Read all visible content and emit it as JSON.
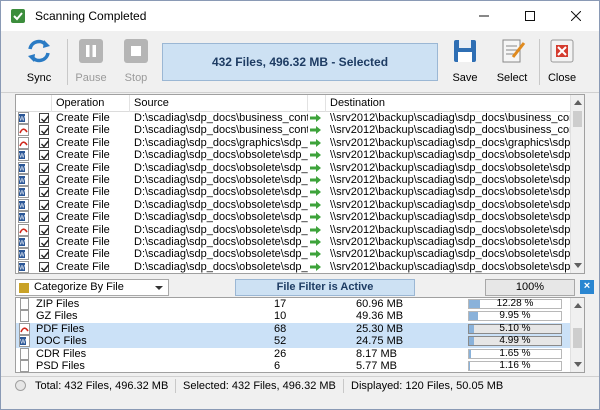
{
  "window": {
    "title": "Scanning Completed"
  },
  "toolbar": {
    "sync": "Sync",
    "pause": "Pause",
    "stop": "Stop",
    "status": "432 Files, 496.32 MB - Selected",
    "save": "Save",
    "select": "Select",
    "close": "Close"
  },
  "grid": {
    "columns": {
      "operation": "Operation",
      "source": "Source",
      "destination": "Destination"
    },
    "rows": [
      {
        "type": "doc",
        "checked": true,
        "operation": "Create File",
        "source": "D:\\scadiag\\sdp_docs\\business_continuit...",
        "destination": "\\\\srv2012\\backup\\scadiag\\sdp_docs\\business_continuity..."
      },
      {
        "type": "pdf",
        "checked": true,
        "operation": "Create File",
        "source": "D:\\scadiag\\sdp_docs\\business_continuit...",
        "destination": "\\\\srv2012\\backup\\scadiag\\sdp_docs\\business_continuity..."
      },
      {
        "type": "pdf",
        "checked": true,
        "operation": "Create File",
        "source": "D:\\scadiag\\sdp_docs\\graphics\\sdp_cd\\s...",
        "destination": "\\\\srv2012\\backup\\scadiag\\sdp_docs\\graphics\\sdp_cd\\sd..."
      },
      {
        "type": "doc",
        "checked": true,
        "operation": "Create File",
        "source": "D:\\scadiag\\sdp_docs\\obsolete\\sdp_artic...",
        "destination": "\\\\srv2012\\backup\\scadiag\\sdp_docs\\obsolete\\sdp_articl..."
      },
      {
        "type": "doc",
        "checked": true,
        "operation": "Create File",
        "source": "D:\\scadiag\\sdp_docs\\obsolete\\sdp_artic...",
        "destination": "\\\\srv2012\\backup\\scadiag\\sdp_docs\\obsolete\\sdp_articl..."
      },
      {
        "type": "doc",
        "checked": true,
        "operation": "Create File",
        "source": "D:\\scadiag\\sdp_docs\\obsolete\\sdp_artic...",
        "destination": "\\\\srv2012\\backup\\scadiag\\sdp_docs\\obsolete\\sdp_articl..."
      },
      {
        "type": "doc",
        "checked": true,
        "operation": "Create File",
        "source": "D:\\scadiag\\sdp_docs\\obsolete\\sdp_artic...",
        "destination": "\\\\srv2012\\backup\\scadiag\\sdp_docs\\obsolete\\sdp_articl..."
      },
      {
        "type": "doc",
        "checked": true,
        "operation": "Create File",
        "source": "D:\\scadiag\\sdp_docs\\obsolete\\sdp_dev_...",
        "destination": "\\\\srv2012\\backup\\scadiag\\sdp_docs\\obsolete\\sdp_dev_s..."
      },
      {
        "type": "doc",
        "checked": true,
        "operation": "Create File",
        "source": "D:\\scadiag\\sdp_docs\\obsolete\\sdp_dev_...",
        "destination": "\\\\srv2012\\backup\\scadiag\\sdp_docs\\obsolete\\sdp_dev_s..."
      },
      {
        "type": "pdf",
        "checked": true,
        "operation": "Create File",
        "source": "D:\\scadiag\\sdp_docs\\obsolete\\sdp_dev_...",
        "destination": "\\\\srv2012\\backup\\scadiag\\sdp_docs\\obsolete\\sdp_dev_s..."
      },
      {
        "type": "doc",
        "checked": true,
        "operation": "Create File",
        "source": "D:\\scadiag\\sdp_docs\\obsolete\\sdp_dev_...",
        "destination": "\\\\srv2012\\backup\\scadiag\\sdp_docs\\obsolete\\sdp_dev_s..."
      },
      {
        "type": "doc",
        "checked": true,
        "operation": "Create File",
        "source": "D:\\scadiag\\sdp_docs\\obsolete\\sdp_dev_...",
        "destination": "\\\\srv2012\\backup\\scadiag\\sdp_docs\\obsolete\\sdp_dev_s..."
      },
      {
        "type": "doc",
        "checked": true,
        "operation": "Create File",
        "source": "D:\\scadiag\\sdp_docs\\obsolete\\sdp_dts_...",
        "destination": "\\\\srv2012\\backup\\scadiag\\sdp_docs\\obsolete\\sdp_dts_s..."
      }
    ]
  },
  "filter": {
    "category": "Categorize By File Extension",
    "status": "File Filter is Active",
    "percent": "100%"
  },
  "categories": [
    {
      "type": "generic",
      "name": "ZIP Files",
      "count": "17",
      "size": "60.96 MB",
      "percent_label": "12.28 %",
      "percent": 12.28,
      "selected": false
    },
    {
      "type": "generic",
      "name": "GZ Files",
      "count": "10",
      "size": "49.36 MB",
      "percent_label": "9.95 %",
      "percent": 9.95,
      "selected": false
    },
    {
      "type": "pdf",
      "name": "PDF Files",
      "count": "68",
      "size": "25.30 MB",
      "percent_label": "5.10 %",
      "percent": 5.1,
      "selected": true
    },
    {
      "type": "doc",
      "name": "DOC Files",
      "count": "52",
      "size": "24.75 MB",
      "percent_label": "4.99 %",
      "percent": 4.99,
      "selected": true
    },
    {
      "type": "generic",
      "name": "CDR Files",
      "count": "26",
      "size": "8.17 MB",
      "percent_label": "1.65 %",
      "percent": 1.65,
      "selected": false
    },
    {
      "type": "generic",
      "name": "PSD Files",
      "count": "6",
      "size": "5.77 MB",
      "percent_label": "1.16 %",
      "percent": 1.16,
      "selected": false
    }
  ],
  "statusbar": {
    "total": "Total: 432 Files, 496.32 MB",
    "selected": "Selected: 432 Files, 496.32 MB",
    "displayed": "Displayed: 120 Files, 50.05 MB"
  },
  "colors": {
    "accent": "#cde1f3",
    "selection": "#cbe1f7",
    "progress": "#8ab2da"
  }
}
